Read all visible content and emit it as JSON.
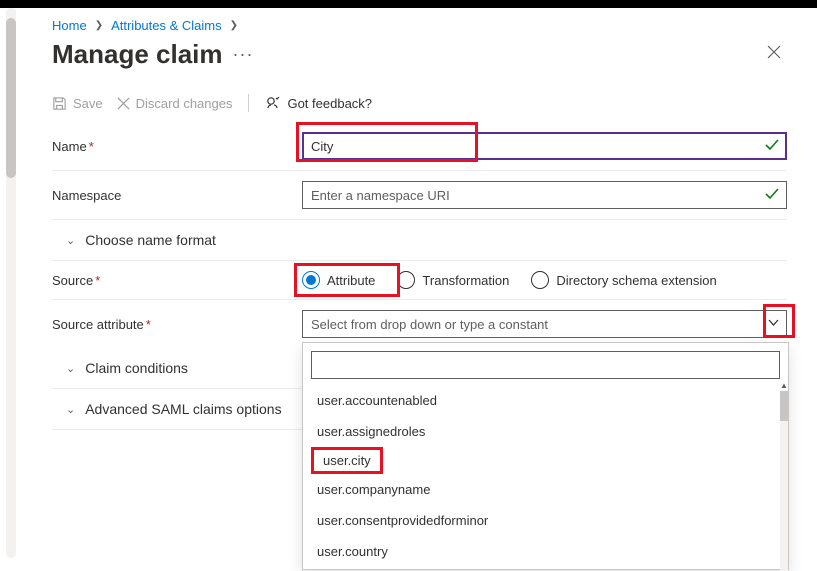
{
  "breadcrumb": {
    "home": "Home",
    "attributes": "Attributes & Claims"
  },
  "page": {
    "title": "Manage claim"
  },
  "toolbar": {
    "save": "Save",
    "discard": "Discard changes",
    "feedback": "Got feedback?"
  },
  "form": {
    "name_label": "Name",
    "name_value": "City",
    "namespace_label": "Namespace",
    "namespace_placeholder": "Enter a namespace URI",
    "choose_format": "Choose name format",
    "source_label": "Source",
    "source_options": {
      "attribute": "Attribute",
      "transformation": "Transformation",
      "extension": "Directory schema extension"
    },
    "source_attr_label": "Source attribute",
    "source_attr_placeholder": "Select from drop down or type a constant",
    "claim_conditions": "Claim conditions",
    "advanced": "Advanced SAML claims options"
  },
  "dropdown": {
    "options": [
      "user.accountenabled",
      "user.assignedroles",
      "user.city",
      "user.companyname",
      "user.consentprovidedforminor",
      "user.country"
    ]
  }
}
